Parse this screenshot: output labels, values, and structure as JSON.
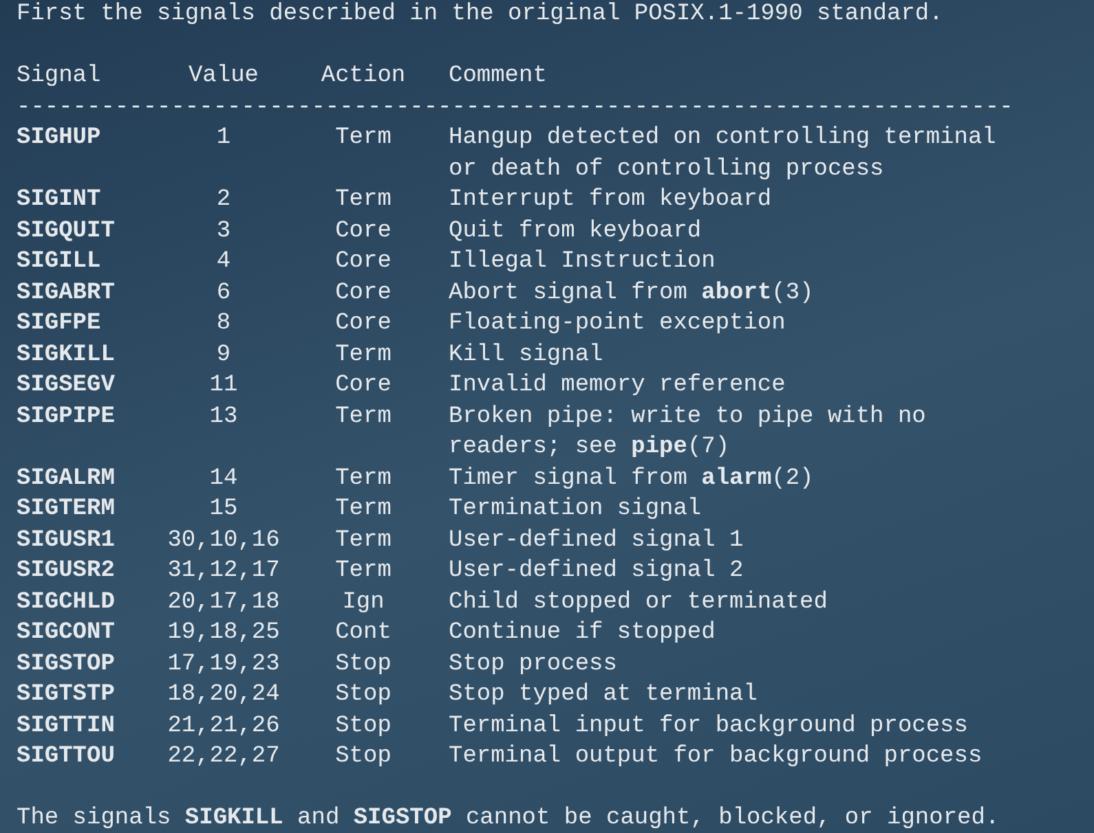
{
  "intro": "First the signals described in the original POSIX.1-1990 standard.",
  "columns": [
    "Signal",
    "Value",
    "Action",
    "Comment"
  ],
  "rule": "-----------------------------------------------------------------------",
  "rows": [
    {
      "signal": "SIGHUP",
      "value": "1",
      "action": "Term",
      "comment": [
        "Hangup detected on controlling terminal",
        "or death of controlling process"
      ]
    },
    {
      "signal": "SIGINT",
      "value": "2",
      "action": "Term",
      "comment": [
        "Interrupt from keyboard"
      ]
    },
    {
      "signal": "SIGQUIT",
      "value": "3",
      "action": "Core",
      "comment": [
        "Quit from keyboard"
      ]
    },
    {
      "signal": "SIGILL",
      "value": "4",
      "action": "Core",
      "comment": [
        "Illegal Instruction"
      ]
    },
    {
      "signal": "SIGABRT",
      "value": "6",
      "action": "Core",
      "comment": [
        "Abort signal from **abort**(3)"
      ]
    },
    {
      "signal": "SIGFPE",
      "value": "8",
      "action": "Core",
      "comment": [
        "Floating-point exception"
      ]
    },
    {
      "signal": "SIGKILL",
      "value": "9",
      "action": "Term",
      "comment": [
        "Kill signal"
      ]
    },
    {
      "signal": "SIGSEGV",
      "value": "11",
      "action": "Core",
      "comment": [
        "Invalid memory reference"
      ]
    },
    {
      "signal": "SIGPIPE",
      "value": "13",
      "action": "Term",
      "comment": [
        "Broken pipe: write to pipe with no",
        "readers; see **pipe**(7)"
      ]
    },
    {
      "signal": "SIGALRM",
      "value": "14",
      "action": "Term",
      "comment": [
        "Timer signal from **alarm**(2)"
      ]
    },
    {
      "signal": "SIGTERM",
      "value": "15",
      "action": "Term",
      "comment": [
        "Termination signal"
      ]
    },
    {
      "signal": "SIGUSR1",
      "value": "30,10,16",
      "action": "Term",
      "comment": [
        "User-defined signal 1"
      ]
    },
    {
      "signal": "SIGUSR2",
      "value": "31,12,17",
      "action": "Term",
      "comment": [
        "User-defined signal 2"
      ]
    },
    {
      "signal": "SIGCHLD",
      "value": "20,17,18",
      "action": "Ign",
      "comment": [
        "Child stopped or terminated"
      ]
    },
    {
      "signal": "SIGCONT",
      "value": "19,18,25",
      "action": "Cont",
      "comment": [
        "Continue if stopped"
      ]
    },
    {
      "signal": "SIGSTOP",
      "value": "17,19,23",
      "action": "Stop",
      "comment": [
        "Stop process"
      ]
    },
    {
      "signal": "SIGTSTP",
      "value": "18,20,24",
      "action": "Stop",
      "comment": [
        "Stop typed at terminal"
      ]
    },
    {
      "signal": "SIGTTIN",
      "value": "21,21,26",
      "action": "Stop",
      "comment": [
        "Terminal input for background process"
      ]
    },
    {
      "signal": "SIGTTOU",
      "value": "22,22,27",
      "action": "Stop",
      "comment": [
        "Terminal output for background process"
      ]
    }
  ],
  "footer": "The signals **SIGKILL** and **SIGSTOP** cannot be caught, blocked, or ignored."
}
